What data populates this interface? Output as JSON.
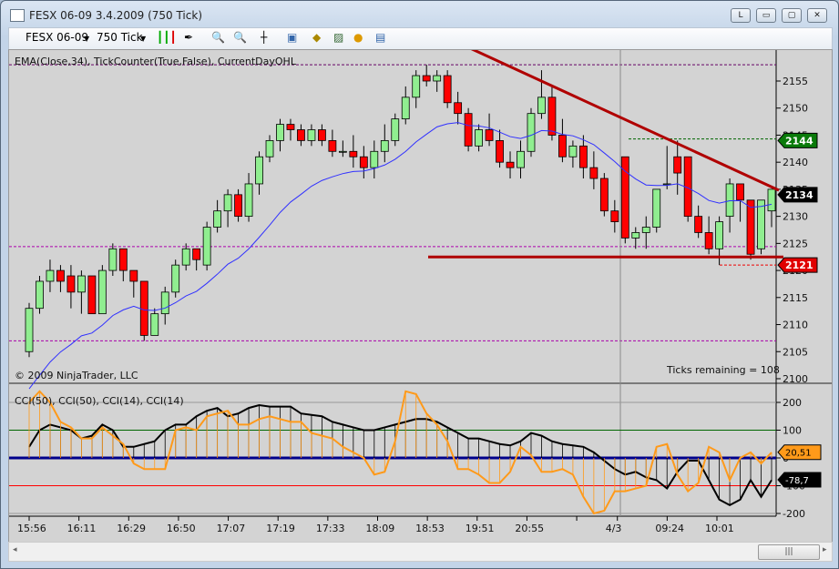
{
  "window": {
    "title": "FESX 06-09  3.4.2009 (750 Tick)",
    "buttons": [
      "L",
      "▭",
      "▢",
      "✕"
    ]
  },
  "toolbar": {
    "instrument": "FESX 06-09",
    "interval": "750 Tick",
    "icons": [
      "bar-type-icon",
      "drawing-tool-icon",
      "zoom-in-icon",
      "zoom-out-icon",
      "crosshair-icon",
      "data-box-icon",
      "strategy-icon",
      "chart-properties-icon",
      "orders-icon",
      "table-icon"
    ]
  },
  "price_panel": {
    "indicator_label": "EMA(Close,34), TickCounter(True,False), CurrentDayOHL",
    "copyright": "© 2009 NinjaTrader, LLC",
    "ticks_remaining": "Ticks remaining = 108",
    "y_ticks": [
      "2155",
      "2150",
      "2145",
      "2140",
      "2135",
      "2130",
      "2125",
      "2120",
      "2115",
      "2110",
      "2105",
      "2100"
    ],
    "markers": [
      {
        "label": "2144",
        "value": 2144,
        "color": "#0a7a0a"
      },
      {
        "label": "2134",
        "value": 2134,
        "color": "#000000"
      },
      {
        "label": "2121",
        "value": 2121,
        "color": "#e00000"
      }
    ],
    "lines": {
      "day_high": 2158,
      "prior_high": 2144.3,
      "level_mid": 2124.4,
      "level_low": 2107,
      "support": 2122.5
    },
    "candles": [
      [
        2105,
        2114,
        2104,
        2113
      ],
      [
        2113,
        2119,
        2112,
        2118
      ],
      [
        2118,
        2122,
        2116,
        2120
      ],
      [
        2120,
        2121,
        2116,
        2118
      ],
      [
        2119,
        2121,
        2113,
        2116
      ],
      [
        2116,
        2120,
        2112,
        2119
      ],
      [
        2119,
        2119,
        2112,
        2112
      ],
      [
        2112,
        2121,
        2112,
        2120
      ],
      [
        2120,
        2125,
        2119,
        2124
      ],
      [
        2124,
        2124,
        2118,
        2120
      ],
      [
        2120,
        2120,
        2115,
        2118
      ],
      [
        2118,
        2118,
        2107,
        2108
      ],
      [
        2108,
        2113,
        2108,
        2112
      ],
      [
        2112,
        2117,
        2110,
        2116
      ],
      [
        2116,
        2122,
        2115,
        2121
      ],
      [
        2121,
        2125,
        2120,
        2124
      ],
      [
        2124,
        2124,
        2120,
        2122
      ],
      [
        2121,
        2129,
        2120,
        2128
      ],
      [
        2128,
        2133,
        2127,
        2131
      ],
      [
        2131,
        2135,
        2128,
        2134
      ],
      [
        2134,
        2135,
        2129,
        2130
      ],
      [
        2130,
        2138,
        2129,
        2136
      ],
      [
        2136,
        2142,
        2134,
        2141
      ],
      [
        2141,
        2145,
        2140,
        2144
      ],
      [
        2144,
        2148,
        2142,
        2147
      ],
      [
        2147,
        2148,
        2144,
        2146
      ],
      [
        2146,
        2147,
        2143,
        2144
      ],
      [
        2144,
        2147,
        2143,
        2146
      ],
      [
        2146,
        2147,
        2143,
        2144
      ],
      [
        2144,
        2146,
        2141,
        2142
      ],
      [
        2142,
        2144,
        2141,
        2142
      ],
      [
        2142,
        2145,
        2139,
        2141
      ],
      [
        2141,
        2143,
        2137,
        2139
      ],
      [
        2139,
        2144,
        2137,
        2142
      ],
      [
        2142,
        2147,
        2140,
        2144
      ],
      [
        2144,
        2149,
        2143,
        2148
      ],
      [
        2148,
        2154,
        2147,
        2152
      ],
      [
        2152,
        2157,
        2150,
        2156
      ],
      [
        2156,
        2158,
        2154,
        2155
      ],
      [
        2155,
        2157,
        2153,
        2156
      ],
      [
        2156,
        2157,
        2150,
        2151
      ],
      [
        2151,
        2153,
        2147,
        2149
      ],
      [
        2149,
        2150,
        2142,
        2143
      ],
      [
        2143,
        2147,
        2142,
        2146
      ],
      [
        2146,
        2149,
        2143,
        2144
      ],
      [
        2144,
        2146,
        2139,
        2140
      ],
      [
        2140,
        2142,
        2137,
        2139
      ],
      [
        2139,
        2144,
        2137,
        2142
      ],
      [
        2142,
        2150,
        2141,
        2149
      ],
      [
        2149,
        2157,
        2148,
        2152
      ],
      [
        2152,
        2154,
        2144,
        2145
      ],
      [
        2145,
        2148,
        2140,
        2141
      ],
      [
        2141,
        2144,
        2139,
        2143
      ],
      [
        2143,
        2145,
        2137,
        2139
      ],
      [
        2139,
        2142,
        2135,
        2137
      ],
      [
        2137,
        2138,
        2130,
        2131
      ],
      [
        2131,
        2133,
        2127,
        2129
      ],
      [
        2141,
        2141,
        2125,
        2126
      ],
      [
        2126,
        2128,
        2124,
        2127
      ],
      [
        2127,
        2130,
        2124,
        2128
      ],
      [
        2128,
        2135,
        2127,
        2135
      ],
      [
        2136,
        2143,
        2135,
        2136
      ],
      [
        2141,
        2144,
        2134,
        2138
      ],
      [
        2141,
        2141,
        2129,
        2130
      ],
      [
        2130,
        2132,
        2126,
        2127
      ],
      [
        2127,
        2130,
        2123,
        2124
      ],
      [
        2124,
        2130,
        2121,
        2129
      ],
      [
        2130,
        2137,
        2127,
        2136
      ],
      [
        2136,
        2136,
        2129,
        2133
      ],
      [
        2133,
        2133,
        2122,
        2123
      ],
      [
        2124,
        2133,
        2123,
        2133
      ],
      [
        2131,
        2135,
        2128,
        2135
      ]
    ]
  },
  "cci_panel": {
    "label": "CCI(50), CCI(50), CCI(14), CCI(14)",
    "y_ticks": [
      "200",
      "100",
      "0",
      "-100",
      "-200"
    ],
    "markers": [
      {
        "label": "20,51",
        "value": 20.51,
        "color": "#ff9a1a"
      },
      {
        "label": "-78,7",
        "value": -78.7,
        "color": "#000000"
      }
    ],
    "cci50": [
      40,
      100,
      120,
      110,
      100,
      70,
      80,
      120,
      100,
      40,
      40,
      50,
      60,
      100,
      120,
      120,
      150,
      170,
      180,
      150,
      160,
      180,
      190,
      185,
      185,
      185,
      160,
      155,
      150,
      130,
      120,
      110,
      100,
      100,
      110,
      120,
      130,
      140,
      140,
      130,
      110,
      90,
      70,
      70,
      60,
      50,
      45,
      60,
      90,
      80,
      60,
      50,
      45,
      40,
      20,
      -10,
      -40,
      -60,
      -50,
      -70,
      -80,
      -110,
      -50,
      -10,
      -10,
      -80,
      -150,
      -170,
      -150,
      -80,
      -140,
      -80
    ],
    "cci14": [
      200,
      240,
      200,
      130,
      110,
      70,
      70,
      110,
      80,
      50,
      -20,
      -40,
      -40,
      -40,
      100,
      110,
      100,
      150,
      160,
      170,
      120,
      120,
      140,
      150,
      140,
      130,
      130,
      90,
      80,
      70,
      40,
      20,
      0,
      -60,
      -50,
      60,
      240,
      230,
      160,
      120,
      60,
      -40,
      -40,
      -60,
      -90,
      -90,
      -50,
      40,
      10,
      -50,
      -50,
      -40,
      -60,
      -140,
      -200,
      -190,
      -120,
      -120,
      -110,
      -100,
      40,
      50,
      -60,
      -120,
      -90,
      40,
      20,
      -80,
      0,
      20,
      -20,
      20
    ]
  },
  "x_axis": {
    "labels": [
      "15:56",
      "16:11",
      "16:29",
      "16:50",
      "17:07",
      "17:19",
      "17:33",
      "18:09",
      "18:53",
      "19:51",
      "20:55",
      "",
      "4/3",
      "09:24",
      "10:01"
    ]
  },
  "colors": {
    "up": "#90ee90",
    "down": "#ff0000",
    "ema": "#3030ff",
    "trend": "#b00000",
    "cci50": "#000000",
    "cci14": "#ff9a1a",
    "zero": "#00008b"
  }
}
